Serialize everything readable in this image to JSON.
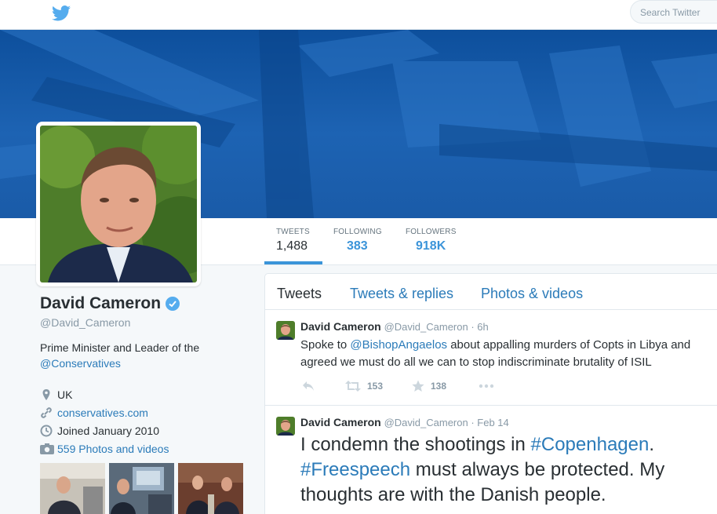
{
  "header": {
    "logo_icon": "twitter-bird-icon",
    "search_placeholder": "Search Twitter"
  },
  "colors": {
    "accent": "#3b94d9",
    "link": "#2b7bb9",
    "banner": "#1a5ba8"
  },
  "stats": [
    {
      "label": "TWEETS",
      "value": "1,488"
    },
    {
      "label": "FOLLOWING",
      "value": "383"
    },
    {
      "label": "FOLLOWERS",
      "value": "918K"
    }
  ],
  "profile": {
    "name": "David Cameron",
    "handle": "@David_Cameron",
    "bio": "Prime Minister and Leader of the",
    "bio_link": "@Conservatives",
    "location": "UK",
    "website": "conservatives.com",
    "joined": "Joined January 2010",
    "photos_label": "559 Photos and videos"
  },
  "tabs": {
    "tweets": "Tweets",
    "replies": "Tweets & replies",
    "media": "Photos & videos"
  },
  "tweets": [
    {
      "name": "David Cameron",
      "meta": "@David_Cameron · 6h",
      "text_before": "Spoke to ",
      "mention": "@BishopAngaelos",
      "text_after": " about appalling murders of Copts in Libya and agreed we must do all we can to stop indiscriminate brutality of ISIL",
      "retweets": "153",
      "favorites": "138"
    },
    {
      "name": "David Cameron",
      "meta": "@David_Cameron · Feb 14",
      "text_before": "I condemn the shootings in ",
      "hashtag1": "#Copenhagen",
      "text_mid": ". ",
      "hashtag2": "#Freespeech",
      "text_after": " must always be protected. My thoughts are with the Danish people."
    }
  ]
}
